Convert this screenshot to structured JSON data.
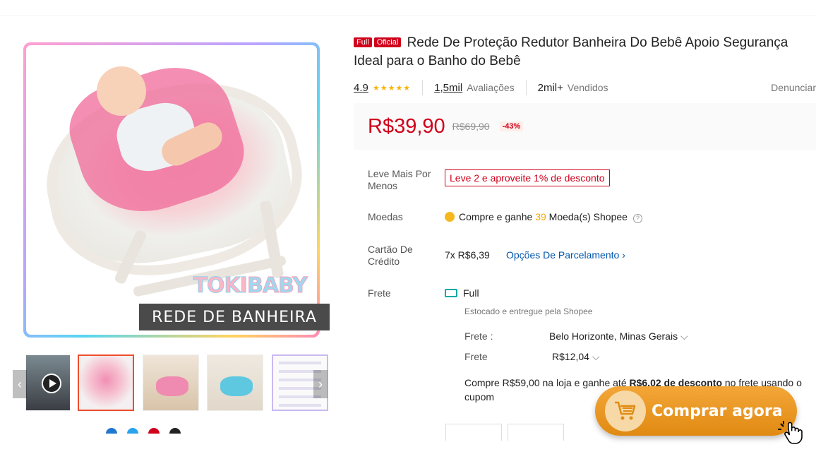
{
  "product": {
    "badge_full": "Full",
    "badge_official": "Oficial",
    "title": "Rede De Proteção Redutor Banheira Do Bebê Apoio Segurança Ideal para o Banho do Bebê",
    "rating": "4.9",
    "stars": "★★★★★",
    "reviews_count": "1,5mil",
    "reviews_label": "Avaliações",
    "sold_count": "2mil+",
    "sold_label": "Vendidos",
    "report_label": "Denunciar"
  },
  "price": {
    "current": "R$39,90",
    "original": "R$69,90",
    "discount": "-43%"
  },
  "details": {
    "promo_label": "Leve Mais Por Menos",
    "promo_value": "Leve 2 e aproveite 1% de desconto",
    "coins_label": "Moedas",
    "coins_prefix": "Compre e ganhe",
    "coins_amount": "39",
    "coins_suffix": "Moeda(s) Shopee",
    "credit_label": "Cartão De Crédito",
    "credit_value": "7x R$6,39",
    "credit_link": "Opções De Parcelamento",
    "shipping_label": "Frete",
    "shipping_type": "Full",
    "shipping_note": "Estocado e entregue pela Shopee",
    "frete_to_label": "Frete :",
    "frete_to_value": "Belo Horizonte, Minas Gerais",
    "frete_cost_label": "Frete",
    "frete_cost_value": "R$12,04",
    "frete_promo_prefix": "Compre R$59,00 na loja e ganhe até",
    "frete_promo_bold": "R$6,02 de desconto",
    "frete_promo_suffix": "no frete usando o cupom"
  },
  "gallery": {
    "brand_part1": "TOKI",
    "brand_part2": "BABY",
    "banner_text": "REDE DE BANHEIRA"
  },
  "cta": {
    "label": "Comprar agora"
  },
  "colors": {
    "accent": "#d0011b",
    "cta": "#e08a12",
    "link": "#0055aa"
  }
}
